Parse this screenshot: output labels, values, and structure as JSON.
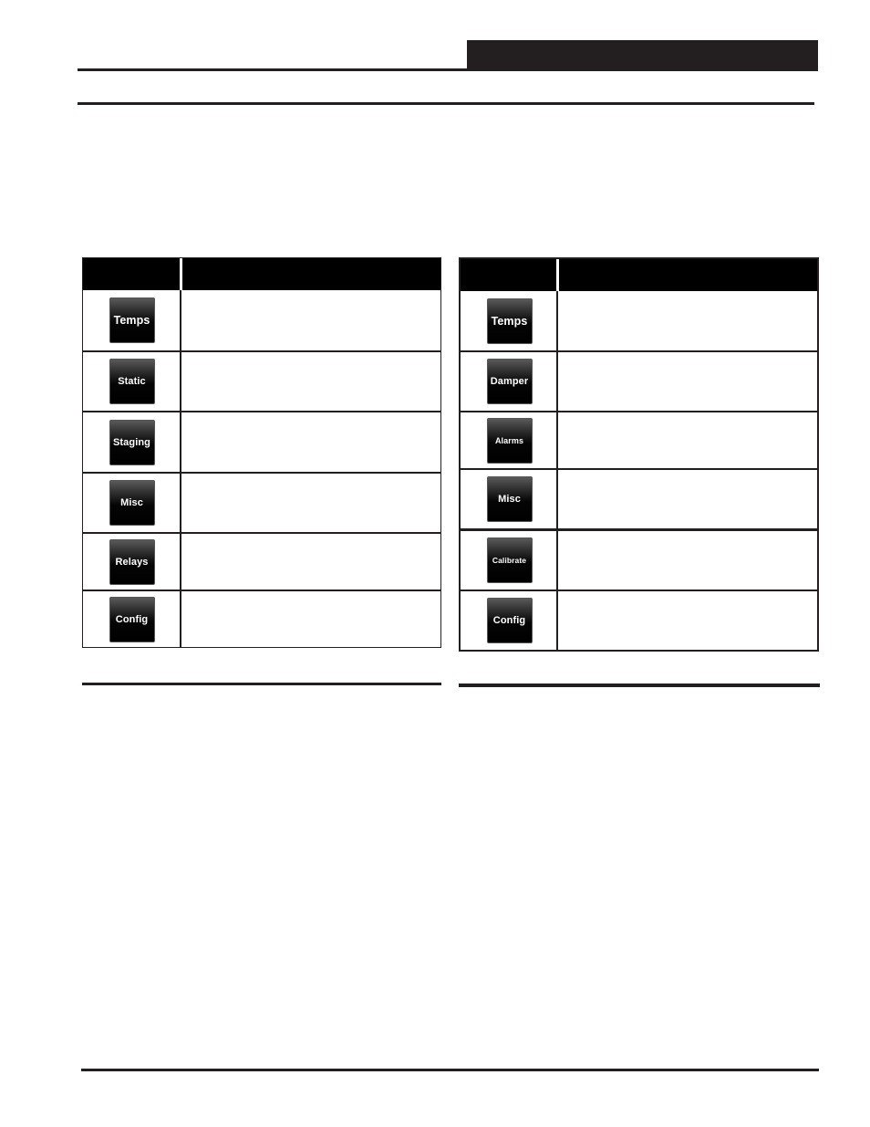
{
  "page": {
    "header_block_text": "",
    "header_text": ""
  },
  "left_table": {
    "headers": [
      "",
      ""
    ],
    "rows": [
      {
        "button": "Temps",
        "description": ""
      },
      {
        "button": "Static",
        "description": ""
      },
      {
        "button": "Staging",
        "description": ""
      },
      {
        "button": "Misc",
        "description": ""
      },
      {
        "button": "Relays",
        "description": ""
      },
      {
        "button": "Config",
        "description": ""
      }
    ]
  },
  "right_table": {
    "headers": [
      "",
      ""
    ],
    "rows": [
      {
        "button": "Temps",
        "description": ""
      },
      {
        "button": "Damper",
        "description": ""
      },
      {
        "button": "Alarms",
        "description": ""
      },
      {
        "button": "Misc",
        "description": ""
      },
      {
        "button": "Calibrate",
        "description": ""
      },
      {
        "button": "Config",
        "description": ""
      }
    ]
  },
  "colors": {
    "rule": "#231f20",
    "header_fill": "#000000",
    "button_text": "#ffffff"
  }
}
